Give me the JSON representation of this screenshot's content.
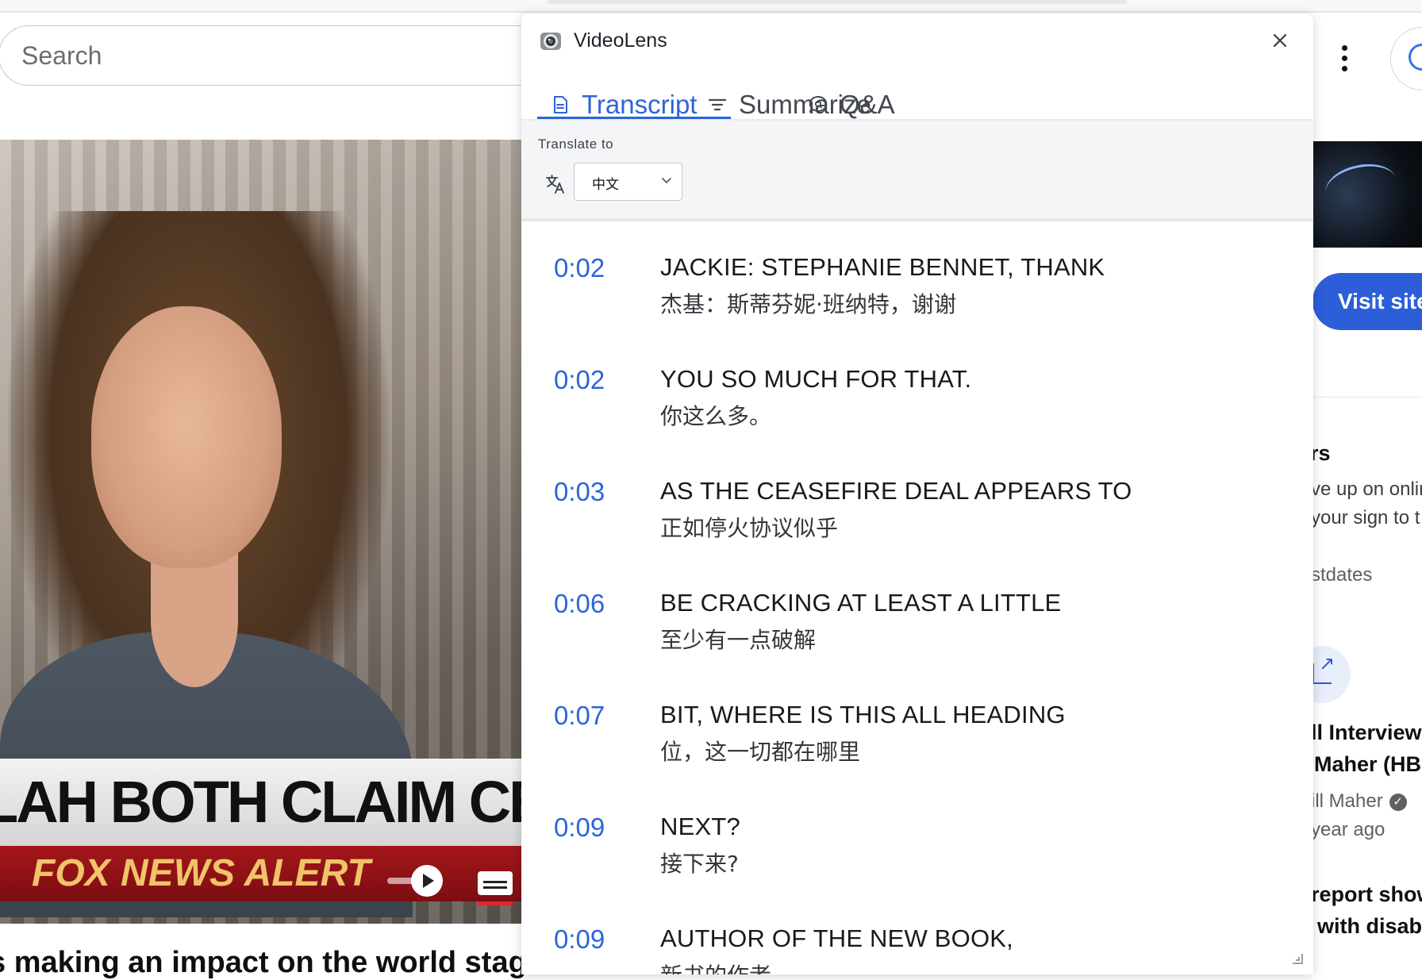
{
  "browser": {
    "search": {
      "placeholder": "Search"
    }
  },
  "video": {
    "lower_third": "LAH BOTH CLAIM CEASEFIRE",
    "alert": "FOX NEWS ALERT",
    "title": "s making an impact on the world stag"
  },
  "sidebar": {
    "visit_label": "Visit site",
    "ad_heading": "ers",
    "ad_line1": "ve up on onlir",
    "ad_line2": "your sign to t",
    "ad_domain": "stdates",
    "rec_title_1": "ll Interview",
    "rec_title_2": "Maher (HB",
    "rec_channel": "ill Maher",
    "rec_age": "year ago",
    "rec2_title_1": "report show",
    "rec2_title_2": "with disabi"
  },
  "panel": {
    "app_name": "VideoLens",
    "tabs": [
      {
        "label": "Transcript",
        "icon": "document-icon",
        "active": true
      },
      {
        "label": "Summarize",
        "icon": "filter-lines-icon",
        "active": false
      },
      {
        "label": "Q&A",
        "icon": "chat-bubble-icon",
        "active": false
      }
    ],
    "translate": {
      "label": "Translate to",
      "selected_language": "中文"
    },
    "transcript": [
      {
        "time": "0:02",
        "text": "JACKIE: STEPHANIE BENNET, THANK",
        "translation": "杰基：斯蒂芬妮·班纳特，谢谢"
      },
      {
        "time": "0:02",
        "text": "YOU SO MUCH FOR THAT.",
        "translation": "你这么多。"
      },
      {
        "time": "0:03",
        "text": "AS THE CEASEFIRE DEAL APPEARS TO",
        "translation": "正如停火协议似乎"
      },
      {
        "time": "0:06",
        "text": "BE CRACKING AT LEAST A LITTLE",
        "translation": "至少有一点破解"
      },
      {
        "time": "0:07",
        "text": "BIT, WHERE IS THIS ALL HEADING",
        "translation": "位，这一切都在哪里"
      },
      {
        "time": "0:09",
        "text": "NEXT?",
        "translation": "接下来?"
      },
      {
        "time": "0:09",
        "text": "AUTHOR OF THE NEW BOOK,",
        "translation": "新书的作者"
      }
    ]
  },
  "colors": {
    "accent": "#2c65d8",
    "visit_button": "#2c5ed8",
    "alert_red": "#a4161a"
  }
}
